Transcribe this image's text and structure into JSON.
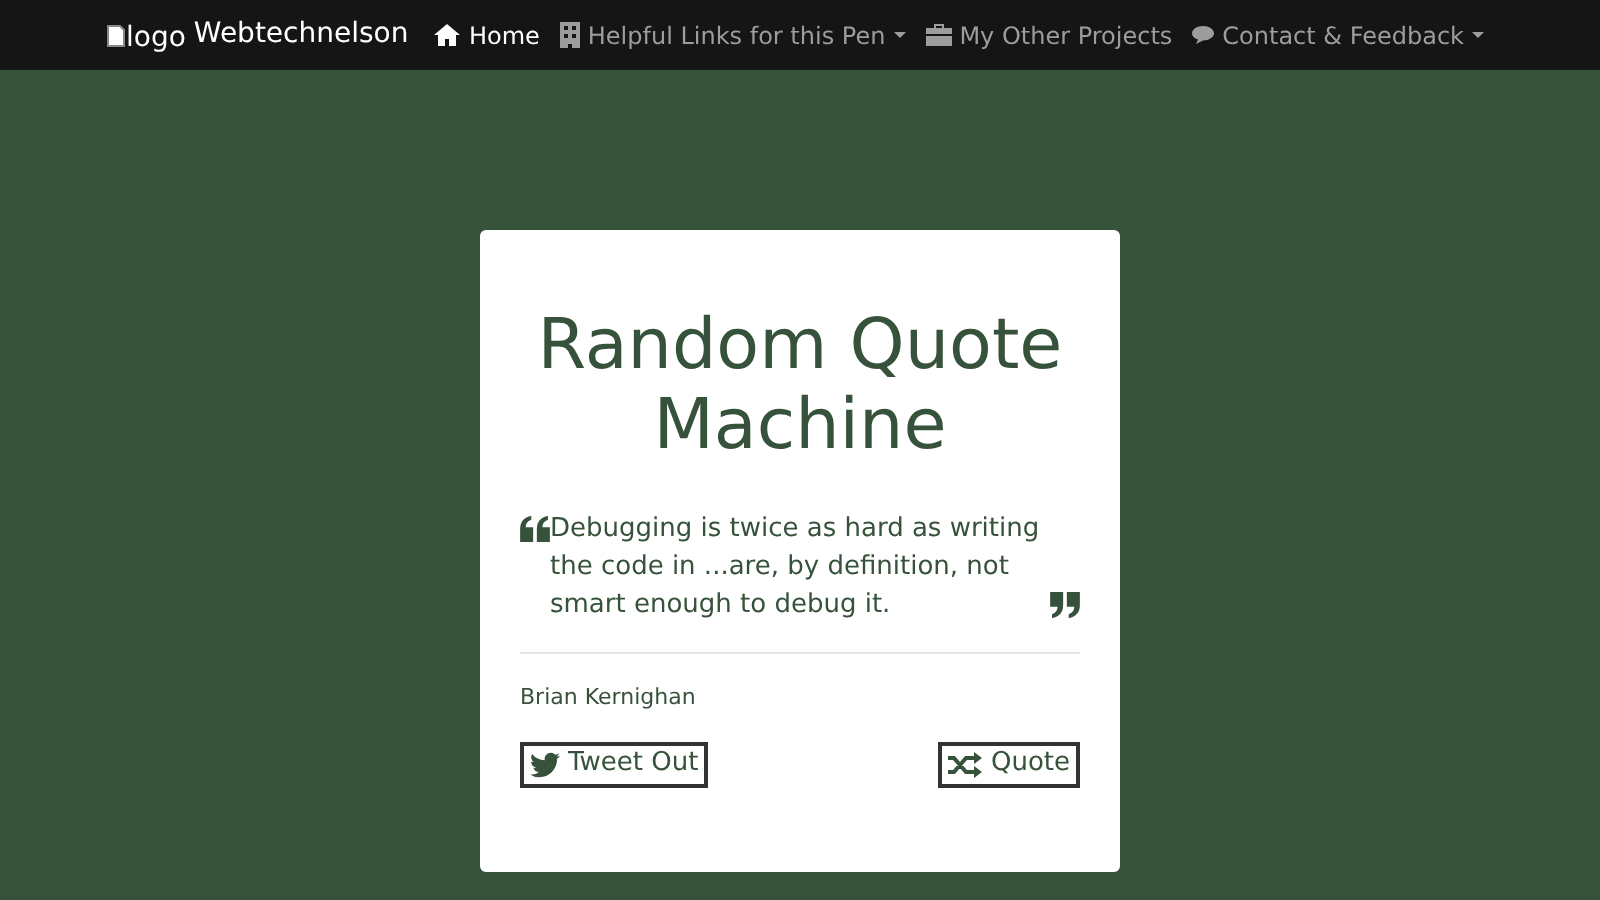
{
  "navbar": {
    "brand": {
      "image_alt": "logo",
      "name": "Webtechnelson"
    },
    "items": [
      {
        "kind": "home",
        "label": "Home",
        "selected": true,
        "dropdown": false
      },
      {
        "kind": "links",
        "label": "Helpful Links for this Pen",
        "selected": false,
        "dropdown": true
      },
      {
        "kind": "projects",
        "label": "My Other Projects",
        "selected": false,
        "dropdown": false
      },
      {
        "kind": "contact",
        "label": "Contact & Feedback",
        "selected": false,
        "dropdown": true
      }
    ]
  },
  "card": {
    "title": "Random Quote Machine",
    "quote": "Debugging is twice as hard as writing the code in ...are, by definition, not smart enough to debug it.",
    "author": "Brian Kernighan",
    "buttons": [
      {
        "kind": "tweet",
        "label": "Tweet Out"
      },
      {
        "kind": "shuffle",
        "label": "Quote"
      }
    ]
  }
}
